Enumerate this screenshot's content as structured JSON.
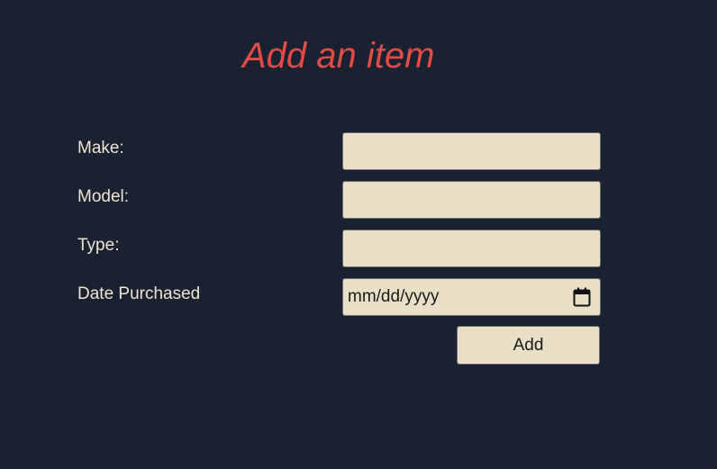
{
  "heading": "Add an item",
  "form": {
    "make_label": "Make:",
    "make_value": "",
    "model_label": "Model:",
    "model_value": "",
    "type_label": "Type:",
    "type_value": "",
    "date_label": "Date Purchased",
    "date_value": "mm/dd/yyyy",
    "date_icon": "calendar-icon",
    "submit_label": "Add"
  },
  "colors": {
    "background": "#1a2130",
    "heading": "#e04a47",
    "label": "#ece5d3",
    "field": "#e8dfc6",
    "field_text": "#1a1a1a"
  }
}
